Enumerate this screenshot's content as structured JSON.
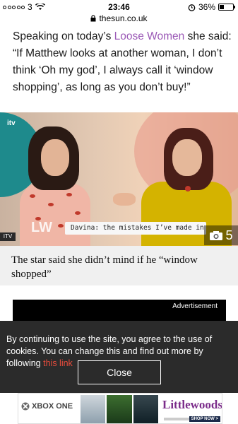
{
  "status_bar": {
    "carrier": "3",
    "time": "23:46",
    "battery": "36%",
    "battery_level": 0.36
  },
  "url_bar": {
    "domain": "thesun.co.uk"
  },
  "article": {
    "text_before_link": "Speaking on today’s ",
    "link_text": "Loose Women",
    "text_after_link": " she said: “If Matthew looks at another woman, I don’t think ‘Oh my god’, I always call it ‘window shopping’, as long as you don’t buy!”"
  },
  "image": {
    "broadcaster_logo": "itv",
    "lower_third_text": "Davina: the mistakes I’ve made in my life",
    "source_tag": "ITV",
    "gallery_count": "5"
  },
  "caption": {
    "text": "The star said she didn’t mind if he “window shopped”"
  },
  "advertisement": {
    "label": "Advertisement"
  },
  "cookie_notice": {
    "text_before_link": "By continuing to use the site, you agree to the use of cookies. You can change this and find out more by following ",
    "link_text": "this link",
    "close_label": "Close"
  },
  "bottom_ad": {
    "brand_left": "XBOX ONE",
    "brand_right": "Littlewoods",
    "cta": "SHOP NOW >"
  },
  "colors": {
    "link_purple": "#9b59b6",
    "cookie_link_red": "#e74c3c",
    "cookie_bg": "#2b2b2b",
    "caption_bg": "#f0f0f0"
  }
}
